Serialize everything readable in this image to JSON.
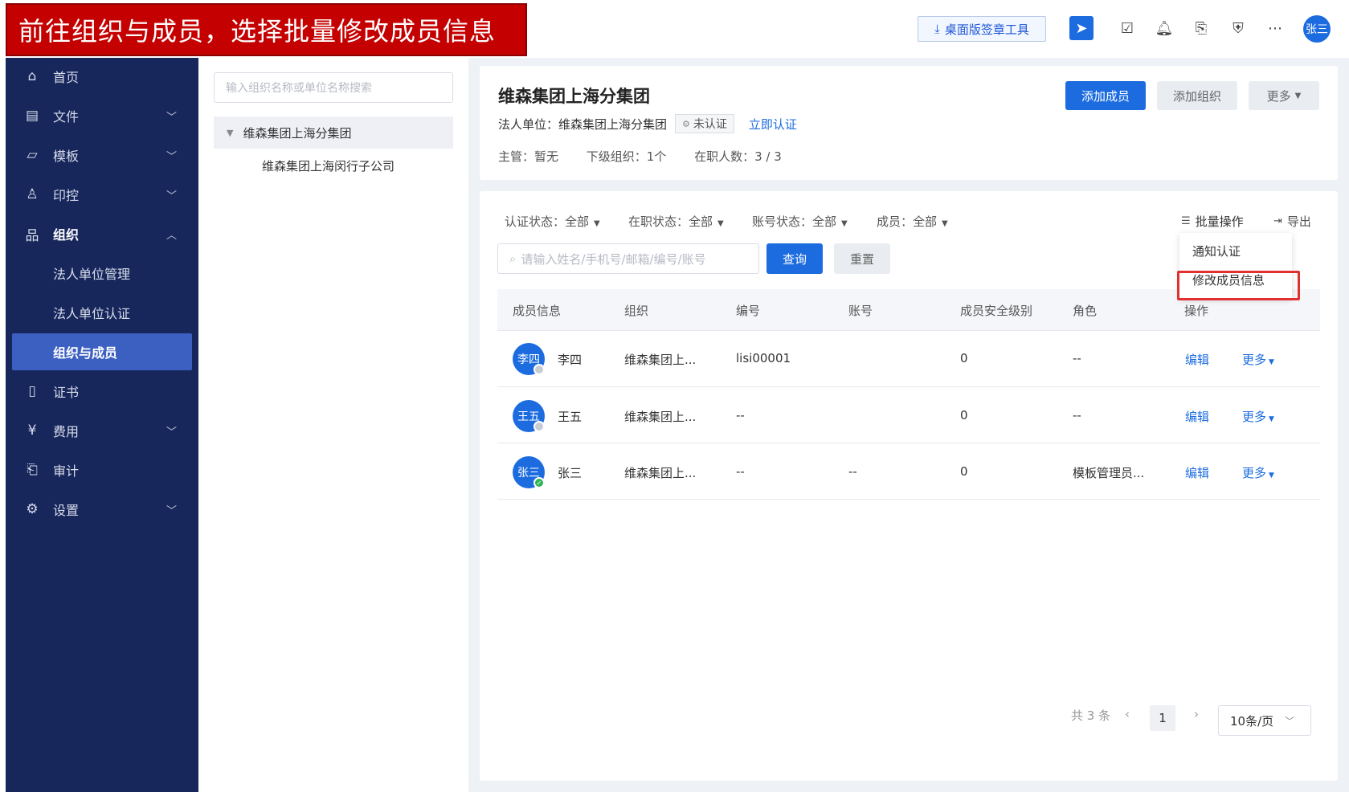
{
  "banner": {
    "text": "前往组织与成员，选择批量修改成员信息"
  },
  "topbar": {
    "desktop_tool_label": "桌面版签章工具",
    "user_avatar": "张三",
    "icons": [
      "download-icon",
      "send-icon",
      "task-icon",
      "bell-icon",
      "document-search-icon",
      "shield-icon",
      "more-icon"
    ]
  },
  "sidebar": {
    "items": [
      {
        "label": "首页",
        "icon": "home-icon"
      },
      {
        "label": "文件",
        "icon": "file-icon"
      },
      {
        "label": "模板",
        "icon": "template-icon"
      },
      {
        "label": "印控",
        "icon": "seal-icon"
      },
      {
        "label": "组织",
        "icon": "org-icon"
      },
      {
        "label": "法人单位管理"
      },
      {
        "label": "法人单位认证"
      },
      {
        "label": "组织与成员"
      },
      {
        "label": "证书",
        "icon": "certificate-icon"
      },
      {
        "label": "费用",
        "icon": "fee-icon"
      },
      {
        "label": "审计",
        "icon": "audit-icon"
      },
      {
        "label": "设置",
        "icon": "gear-icon"
      }
    ]
  },
  "tree": {
    "search_placeholder": "输入组织名称或单位名称搜索",
    "root": "维森集团上海分集团",
    "child": "维森集团上海闵行子公司"
  },
  "header": {
    "title": "维森集团上海分集团",
    "legal_prefix": "法人单位：维森集团上海分集团",
    "status": "未认证",
    "verify_link": "立即认证",
    "manager": "主管：暂无",
    "sub_orgs": "下级组织：1个",
    "active_count": "在职人数：3 / 3",
    "add_member": "添加成员",
    "add_org": "添加组织",
    "more": "更多"
  },
  "filters": {
    "auth_status": "认证状态：全部",
    "job_status": "在职状态：全部",
    "account_status": "账号状态：全部",
    "member": "成员：全部",
    "search_placeholder": "请输入姓名/手机号/邮箱/编号/账号",
    "query": "查询",
    "reset": "重置",
    "batch": "批量操作",
    "export": "导出"
  },
  "dropdown": {
    "notify": "通知认证",
    "modify": "修改成员信息"
  },
  "table": {
    "headers": [
      "成员信息",
      "组织",
      "编号",
      "账号",
      "成员安全级别",
      "角色",
      "操作"
    ],
    "rows": [
      {
        "avatar": "李四",
        "name": "李四",
        "org": "维森集团上...",
        "code": "lisi00001",
        "account": "",
        "level": "0",
        "role": "--",
        "edit": "编辑",
        "more": "更多",
        "badge": "gray"
      },
      {
        "avatar": "王五",
        "name": "王五",
        "org": "维森集团上...",
        "code": "--",
        "account": "",
        "level": "0",
        "role": "--",
        "edit": "编辑",
        "more": "更多",
        "badge": "gray"
      },
      {
        "avatar": "张三",
        "name": "张三",
        "org": "维森集团上...",
        "code": "--",
        "account": "--",
        "level": "0",
        "role": "模板管理员...",
        "edit": "编辑",
        "more": "更多",
        "badge": "green"
      }
    ]
  },
  "pagination": {
    "total": "共 3 条",
    "page": "1",
    "page_size": "10条/页"
  },
  "colors": {
    "sidebar_bg": "#17275c",
    "primary": "#1c6ce0",
    "banner_bg": "#c40000",
    "highlight": "#e03030"
  }
}
